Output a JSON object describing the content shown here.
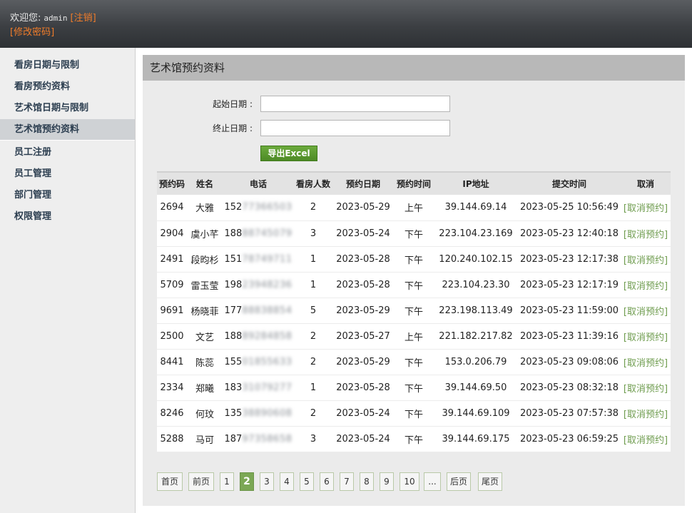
{
  "header": {
    "welcome_label": "欢迎您:",
    "username": "admin",
    "logout_label": "[注销]",
    "change_password_label": "[修改密码]"
  },
  "sidebar": {
    "items": [
      {
        "label": "看房日期与限制",
        "active": false
      },
      {
        "label": "看房预约资料",
        "active": false
      },
      {
        "label": "艺术馆日期与限制",
        "active": false
      },
      {
        "label": "艺术馆预约资料",
        "active": true
      },
      {
        "label": "员工注册",
        "active": false
      },
      {
        "label": "员工管理",
        "active": false
      },
      {
        "label": "部门管理",
        "active": false
      },
      {
        "label": "权限管理",
        "active": false
      }
    ]
  },
  "main": {
    "title": "艺术馆预约资料",
    "form": {
      "start_date_label": "起始日期 :",
      "start_date_value": "",
      "end_date_label": "终止日期 :",
      "end_date_value": "",
      "export_button": "导出Excel"
    },
    "table": {
      "headers": [
        "预约码",
        "姓名",
        "电话",
        "看房人数",
        "预约日期",
        "预约时间",
        "IP地址",
        "提交时间",
        "取消"
      ],
      "rows": [
        {
          "code": "2694",
          "name": "大雅",
          "phone_prefix": "152",
          "phone_rest": "77366503",
          "people": "2",
          "date": "2023-05-29",
          "time": "上午",
          "ip": "39.144.69.14",
          "submitted": "2023-05-25 10:56:49",
          "cancel": "[取消预约]"
        },
        {
          "code": "2904",
          "name": "虞小芊",
          "phone_prefix": "188",
          "phone_rest": "88745079",
          "people": "3",
          "date": "2023-05-24",
          "time": "下午",
          "ip": "223.104.23.169",
          "submitted": "2023-05-23 12:40:18",
          "cancel": "[取消预约]"
        },
        {
          "code": "2491",
          "name": "段昀杉",
          "phone_prefix": "151",
          "phone_rest": "78749711",
          "people": "1",
          "date": "2023-05-28",
          "time": "下午",
          "ip": "120.240.102.15",
          "submitted": "2023-05-23 12:17:38",
          "cancel": "[取消预约]"
        },
        {
          "code": "5709",
          "name": "雷玉莹",
          "phone_prefix": "198",
          "phone_rest": "23948236",
          "people": "1",
          "date": "2023-05-28",
          "time": "下午",
          "ip": "223.104.23.30",
          "submitted": "2023-05-23 12:17:19",
          "cancel": "[取消预约]"
        },
        {
          "code": "9691",
          "name": "杨晓菲",
          "phone_prefix": "177",
          "phone_rest": "88838854",
          "people": "5",
          "date": "2023-05-29",
          "time": "下午",
          "ip": "223.198.113.49",
          "submitted": "2023-05-23 11:59:00",
          "cancel": "[取消预约]"
        },
        {
          "code": "2500",
          "name": "文艺",
          "phone_prefix": "188",
          "phone_rest": "89284858",
          "people": "2",
          "date": "2023-05-27",
          "time": "上午",
          "ip": "221.182.217.82",
          "submitted": "2023-05-23 11:39:16",
          "cancel": "[取消预约]"
        },
        {
          "code": "8441",
          "name": "陈蕊",
          "phone_prefix": "155",
          "phone_rest": "01855633",
          "people": "2",
          "date": "2023-05-29",
          "time": "下午",
          "ip": "153.0.206.79",
          "submitted": "2023-05-23 09:08:06",
          "cancel": "[取消预约]"
        },
        {
          "code": "2334",
          "name": "郑曦",
          "phone_prefix": "183",
          "phone_rest": "31079277",
          "people": "1",
          "date": "2023-05-28",
          "time": "下午",
          "ip": "39.144.69.50",
          "submitted": "2023-05-23 08:32:18",
          "cancel": "[取消预约]"
        },
        {
          "code": "8246",
          "name": "何玟",
          "phone_prefix": "135",
          "phone_rest": "38890608",
          "people": "2",
          "date": "2023-05-24",
          "time": "下午",
          "ip": "39.144.69.109",
          "submitted": "2023-05-23 07:57:38",
          "cancel": "[取消预约]"
        },
        {
          "code": "5288",
          "name": "马可",
          "phone_prefix": "187",
          "phone_rest": "97358658",
          "people": "3",
          "date": "2023-05-24",
          "time": "下午",
          "ip": "39.144.69.175",
          "submitted": "2023-05-23 06:59:25",
          "cancel": "[取消预约]"
        }
      ]
    },
    "pagination": {
      "first": "首页",
      "prev": "前页",
      "pages": [
        "1",
        "2",
        "3",
        "4",
        "5",
        "6",
        "7",
        "8",
        "9",
        "10"
      ],
      "current_page": "2",
      "ellipsis": "...",
      "next": "后页",
      "last": "尾页"
    }
  }
}
